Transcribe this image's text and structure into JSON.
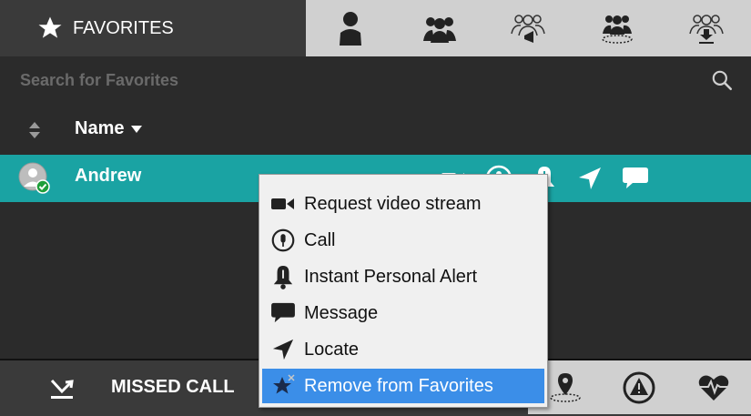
{
  "favorites_tab": {
    "label": "FAVORITES",
    "icon": "star-icon"
  },
  "header_tabs": [
    {
      "icon": "person-icon"
    },
    {
      "icon": "group-icon"
    },
    {
      "icon": "group-broadcast-icon"
    },
    {
      "icon": "group-area-icon"
    },
    {
      "icon": "group-download-icon"
    }
  ],
  "search": {
    "placeholder": "Search for Favorites",
    "value": ""
  },
  "list_header": {
    "name_label": "Name"
  },
  "contacts": [
    {
      "name": "Andrew",
      "status": "online"
    }
  ],
  "context_menu": {
    "items": [
      {
        "label": "Request video stream",
        "icon": "video-camera-icon"
      },
      {
        "label": "Call",
        "icon": "microphone-icon"
      },
      {
        "label": "Instant Personal Alert",
        "icon": "bell-icon"
      },
      {
        "label": "Message",
        "icon": "chat-bubble-icon"
      },
      {
        "label": "Locate",
        "icon": "location-arrow-icon"
      },
      {
        "label": "Remove from Favorites",
        "icon": "star-remove-icon",
        "highlighted": true
      }
    ]
  },
  "bottom_bar": {
    "missed_calls_label": "MISSED CALL",
    "icons": [
      "location-pin-icon",
      "warning-icon",
      "heartbeat-icon"
    ]
  },
  "colors": {
    "accent": "#1aa3a3",
    "menu_highlight": "#3b8ee8",
    "dark_bg": "#2b2b2b",
    "tab_bg": "#d0d0d0"
  }
}
